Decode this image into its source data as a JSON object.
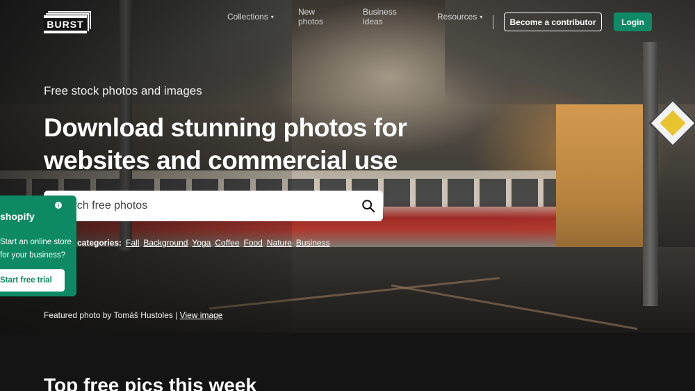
{
  "header": {
    "logo_text": "BURST",
    "nav": [
      {
        "label": "Collections",
        "has_dropdown": true
      },
      {
        "label": "New photos",
        "has_dropdown": false
      },
      {
        "label": "Business ideas",
        "has_dropdown": false
      },
      {
        "label": "Resources",
        "has_dropdown": true
      }
    ],
    "contributor_label": "Become a contributor",
    "login_label": "Login"
  },
  "hero": {
    "kicker": "Free stock photos and images",
    "headline": "Download stunning photos for websites and commercial use",
    "search": {
      "placeholder": "Search free photos",
      "icon": "search-icon"
    },
    "categories_label": "Popular categories:",
    "categories": [
      "Fall",
      "Background",
      "Yoga",
      "Coffee",
      "Food",
      "Nature",
      "Business"
    ],
    "credit_prefix": "Featured photo by Tomáš Hustoles | ",
    "credit_link": "View image"
  },
  "promo": {
    "brand": "shopify",
    "info_icon": "info-icon",
    "text": "Start an online store for your business?",
    "button_label": "Start free trial"
  },
  "section": {
    "title": "Top free pics this week"
  },
  "colors": {
    "accent_green": "#0f8a66",
    "page_dark": "#141414"
  }
}
